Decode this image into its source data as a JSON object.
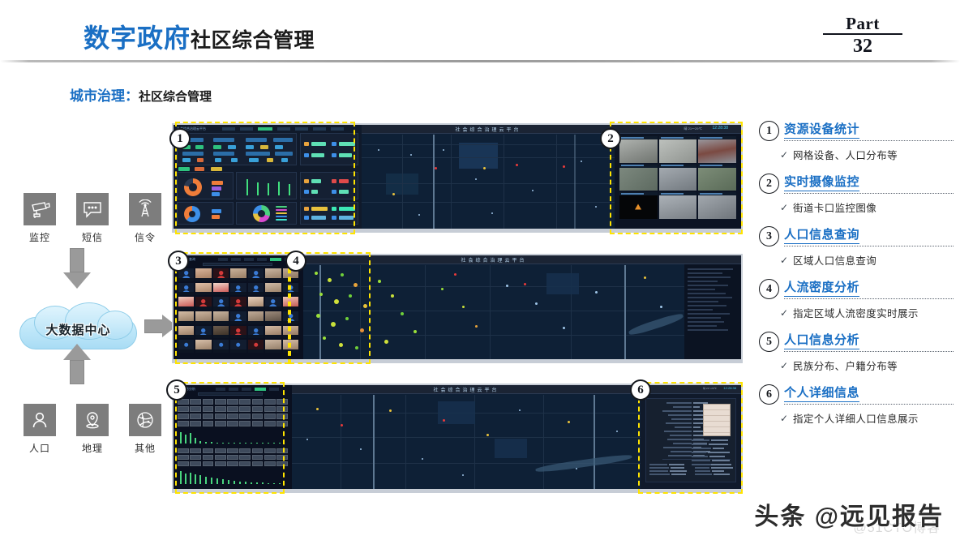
{
  "header": {
    "title_blue": "数字政府",
    "title_black": "社区综合管理",
    "part_word": "Part",
    "part_number": "32"
  },
  "subtitle": {
    "blue": "城市治理：",
    "black": "社区综合管理"
  },
  "left_flow": {
    "top_icons": [
      {
        "label": "监控",
        "icon": "cctv-camera-icon"
      },
      {
        "label": "短信",
        "icon": "speech-bubble-icon"
      },
      {
        "label": "信令",
        "icon": "antenna-tower-icon"
      }
    ],
    "bottom_icons": [
      {
        "label": "人口",
        "icon": "person-icon"
      },
      {
        "label": "地理",
        "icon": "map-pin-icon"
      },
      {
        "label": "其他",
        "icon": "globe-network-icon"
      }
    ],
    "cloud_label": "大数据中心",
    "arrow_down": "arrow-down-icon",
    "arrow_up": "arrow-up-icon",
    "arrow_right": "arrow-right-icon"
  },
  "screens": {
    "platform_title": "社会综合治理云平台",
    "clock": "12:28:38",
    "weather": "晴 21～29℃",
    "badges": [
      "1",
      "2",
      "3",
      "4",
      "5",
      "6"
    ]
  },
  "features": [
    {
      "num": "1",
      "title": "资源设备统计",
      "check": "✓",
      "desc": "网格设备、人口分布等"
    },
    {
      "num": "2",
      "title": "实时摄像监控",
      "check": "✓",
      "desc": "街道卡口监控图像"
    },
    {
      "num": "3",
      "title": "人口信息查询",
      "check": "✓",
      "desc": "区域人口信息查询"
    },
    {
      "num": "4",
      "title": "人流密度分析",
      "check": "✓",
      "desc": "指定区域人流密度实时展示"
    },
    {
      "num": "5",
      "title": "人口信息分析",
      "check": "✓",
      "desc": "民族分布、户籍分布等"
    },
    {
      "num": "6",
      "title": "个人详细信息",
      "check": "✓",
      "desc": "指定个人详细人口信息展示"
    }
  ],
  "watermark": {
    "main": "头条 @远见报告",
    "sub": "@51CTO博客"
  },
  "colors": {
    "brand_blue": "#1a6fc4",
    "callout_yellow": "#ffe400",
    "screen_bg": "#0e2036",
    "icon_gray": "#7d7d7d"
  }
}
